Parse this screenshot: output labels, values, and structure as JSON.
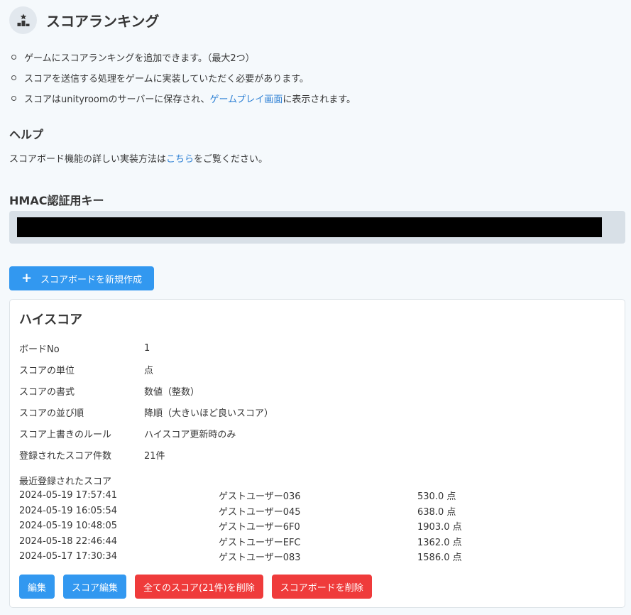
{
  "header": {
    "icon": "ranking-podium-icon",
    "title": "スコアランキング"
  },
  "bullets": [
    {
      "text": "ゲームにスコアランキングを追加できます。（最大2つ）"
    },
    {
      "text": "スコアを送信する処理をゲームに実装していただく必要があります。"
    },
    {
      "pre": "スコアはunityroomのサーバーに保存され、",
      "link": "ゲームプレイ画面",
      "post": "に表示されます。"
    }
  ],
  "help": {
    "title": "ヘルプ",
    "pre": "スコアボード機能の詳しい実装方法は",
    "link": "こちら",
    "post": "をご覧ください。"
  },
  "hmac": {
    "title": "HMAC認証用キー"
  },
  "new_board_button": "スコアボードを新規作成",
  "board": {
    "title": "ハイスコア",
    "properties": [
      {
        "label": "ボードNo",
        "value": "1"
      },
      {
        "label": "スコアの単位",
        "value": "点"
      },
      {
        "label": "スコアの書式",
        "value": "数値（整数）"
      },
      {
        "label": "スコアの並び順",
        "value": "降順（大きいほど良いスコア）"
      },
      {
        "label": "スコア上書きのルール",
        "value": "ハイスコア更新時のみ"
      },
      {
        "label": "登録されたスコア件数",
        "value": "21件"
      }
    ],
    "recent_title": "最近登録されたスコア",
    "recent_scores": [
      {
        "date": "2024-05-19 17:57:41",
        "user": "ゲストユーザー036",
        "score": "530.0 点"
      },
      {
        "date": "2024-05-19 16:05:54",
        "user": "ゲストユーザー045",
        "score": "638.0 点"
      },
      {
        "date": "2024-05-19 10:48:05",
        "user": "ゲストユーザー6F0",
        "score": "1903.0 点"
      },
      {
        "date": "2024-05-18 22:46:44",
        "user": "ゲストユーザーEFC",
        "score": "1362.0 点"
      },
      {
        "date": "2024-05-17 17:30:34",
        "user": "ゲストユーザー083",
        "score": "1586.0 点"
      }
    ],
    "actions": {
      "edit": "編集",
      "edit_scores": "スコア編集",
      "delete_all_scores": "全てのスコア(21件)を削除",
      "delete_board": "スコアボードを削除"
    }
  },
  "colors": {
    "background": "#f5f9fc",
    "primary": "#3298f0",
    "danger": "#ef3b3b",
    "link": "#2b7fd4"
  }
}
